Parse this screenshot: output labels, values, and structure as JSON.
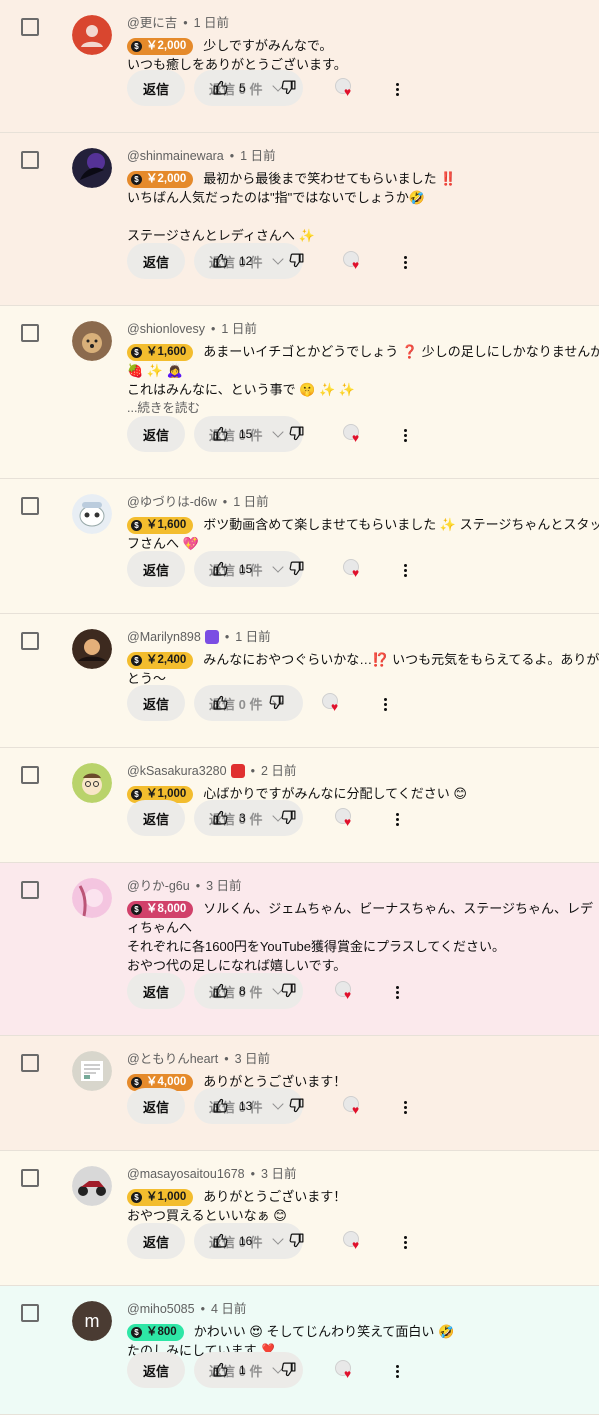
{
  "reply_label": "返信",
  "colors": {
    "orange_badge": "#e58a2b",
    "gold_badge": "#f3bd2e",
    "pink_badge": "#d1416a",
    "green_badge": "#2ee6a6"
  },
  "comments": [
    {
      "author": "@更に吉",
      "time": "1 日前",
      "amount": "￥2,000",
      "lines": [
        "少しですがみんなで。",
        "いつも癒しをありがとうございます。"
      ],
      "likes": "5",
      "reply_count_label": "返信 0 件",
      "bg": "#fbefe5"
    },
    {
      "author": "@shinmainewara",
      "time": "1 日前",
      "amount": "￥2,000",
      "lines": [
        "最初から最後まで笑わせてもらいました ‼️",
        "いちばん人気だったのは\"指\"ではないでしょうか🤣",
        "",
        "ステージさんとレディさんへ ✨"
      ],
      "likes": "12",
      "reply_count_label": "返信 0 件",
      "bg": "#fbefe5"
    },
    {
      "author": "@shionlovesy",
      "time": "1 日前",
      "amount": "￥1,600",
      "lines": [
        "あまーいイチゴとかどうでしょう ❓ 少しの足しにしかなりませんが",
        "🍓 ✨ 🙇‍♀️",
        "これはみんなに、という事で 🤫 ✨ ✨"
      ],
      "more": "...続きを読む",
      "likes": "15",
      "reply_count_label": "返信 0 件",
      "bg": "#fdf8ec"
    },
    {
      "author": "@ゆづりは-d6w",
      "time": "1 日前",
      "amount": "￥1,600",
      "lines": [
        "ボツ動画含めて楽しませてもらいました ✨ ステージちゃんとスタッ",
        "フさんへ 💖"
      ],
      "likes": "15",
      "reply_count_label": "返信 0 件",
      "bg": "#fdf8ec"
    },
    {
      "author": "@Marilyn898",
      "time": "1 日前",
      "amount": "￥2,400",
      "lines": [
        "みんなにおやつぐらいかな…⁉️ いつも元気をもらえてるよ。ありが",
        "とう〜"
      ],
      "likes": "",
      "reply_count_label": "返信 0 件",
      "bg": "#fdf8ec"
    },
    {
      "author": "@kSasakura3280",
      "time": "2 日前",
      "amount": "￥1,000",
      "lines": [
        "心ばかりですがみんなに分配してください 😊"
      ],
      "likes": "3",
      "reply_count_label": "返信 0 件",
      "bg": "#fdf8ec"
    },
    {
      "author": "@りか-g6u",
      "time": "3 日前",
      "amount": "￥8,000",
      "lines": [
        "ソルくん、ジェムちゃん、ビーナスちゃん、ステージちゃん、レデ",
        "ィちゃんへ",
        "それぞれに各1600円をYouTube獲得賞金にプラスしてください。",
        "おやつ代の足しになれば嬉しいです。"
      ],
      "likes": "8",
      "reply_count_label": "返信 0 件",
      "bg": "#fbe9ec"
    },
    {
      "author": "@ともりんheart",
      "time": "3 日前",
      "amount": "￥4,000",
      "lines": [
        "ありがとうございます！"
      ],
      "likes": "13",
      "reply_count_label": "返信 0 件",
      "bg": "#fbefe5"
    },
    {
      "author": "@masayosaitou1678",
      "time": "3 日前",
      "amount": "￥1,000",
      "lines": [
        "ありがとうございます！",
        "おやつ買えるといいなぁ 😊"
      ],
      "likes": "16",
      "reply_count_label": "返信 0 件",
      "bg": "#fdf8ec"
    },
    {
      "author": "@miho5085",
      "time": "4 日前",
      "amount": "￥800",
      "lines": [
        "かわいい 😍 そしてじんわり笑えて面白い 🤣",
        "たのしみにしています ❣️"
      ],
      "likes": "1",
      "reply_count_label": "返信 0 件",
      "bg": "#eefbf6",
      "avatar_letter": "m"
    }
  ]
}
